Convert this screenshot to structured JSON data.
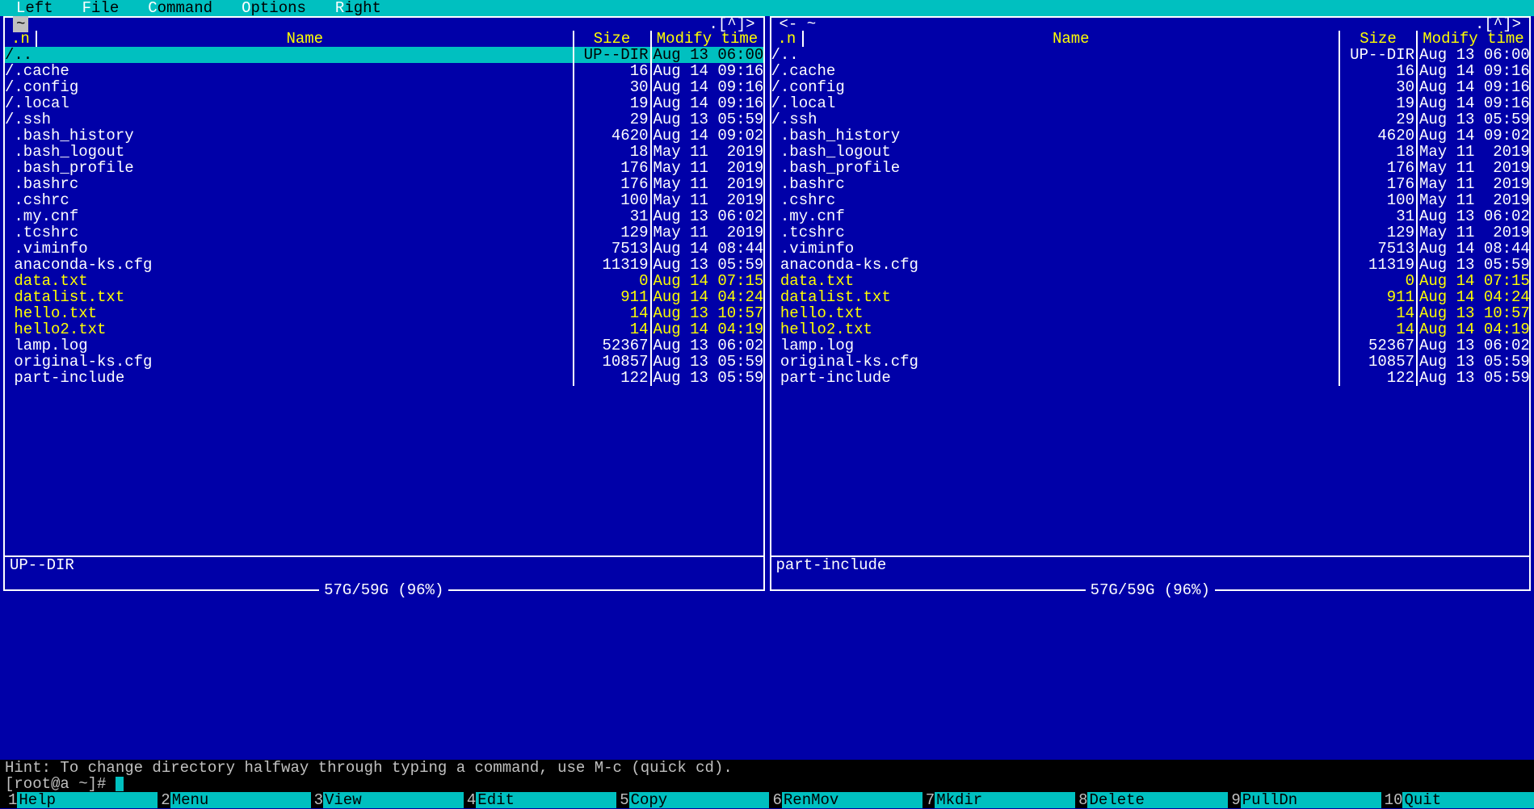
{
  "menu": {
    "left": "Left",
    "file": "File",
    "command": "Command",
    "options": "Options",
    "right": "Right"
  },
  "panel_header": {
    "n": ".n",
    "name": "Name",
    "size": "Size",
    "mtime": "Modify time"
  },
  "indicator": ".[^]>",
  "disk": "57G/59G (96%)",
  "left_panel": {
    "path": "~",
    "path_prefix": "<- ",
    "status": "UP--DIR",
    "selected": 0,
    "files": [
      {
        "name": "/..",
        "size": "UP--DIR",
        "mtime": "Aug 13 06:00",
        "cls": ""
      },
      {
        "name": "/.cache",
        "size": "16",
        "mtime": "Aug 14 09:16",
        "cls": ""
      },
      {
        "name": "/.config",
        "size": "30",
        "mtime": "Aug 14 09:16",
        "cls": ""
      },
      {
        "name": "/.local",
        "size": "19",
        "mtime": "Aug 14 09:16",
        "cls": ""
      },
      {
        "name": "/.ssh",
        "size": "29",
        "mtime": "Aug 13 05:59",
        "cls": ""
      },
      {
        "name": " .bash_history",
        "size": "4620",
        "mtime": "Aug 14 09:02",
        "cls": ""
      },
      {
        "name": " .bash_logout",
        "size": "18",
        "mtime": "May 11  2019",
        "cls": ""
      },
      {
        "name": " .bash_profile",
        "size": "176",
        "mtime": "May 11  2019",
        "cls": ""
      },
      {
        "name": " .bashrc",
        "size": "176",
        "mtime": "May 11  2019",
        "cls": ""
      },
      {
        "name": " .cshrc",
        "size": "100",
        "mtime": "May 11  2019",
        "cls": ""
      },
      {
        "name": " .my.cnf",
        "size": "31",
        "mtime": "Aug 13 06:02",
        "cls": ""
      },
      {
        "name": " .tcshrc",
        "size": "129",
        "mtime": "May 11  2019",
        "cls": ""
      },
      {
        "name": " .viminfo",
        "size": "7513",
        "mtime": "Aug 14 08:44",
        "cls": ""
      },
      {
        "name": " anaconda-ks.cfg",
        "size": "11319",
        "mtime": "Aug 13 05:59",
        "cls": ""
      },
      {
        "name": " data.txt",
        "size": "0",
        "mtime": "Aug 14 07:15",
        "cls": "y"
      },
      {
        "name": " datalist.txt",
        "size": "911",
        "mtime": "Aug 14 04:24",
        "cls": "y"
      },
      {
        "name": " hello.txt",
        "size": "14",
        "mtime": "Aug 13 10:57",
        "cls": "y"
      },
      {
        "name": " hello2.txt",
        "size": "14",
        "mtime": "Aug 14 04:19",
        "cls": "y"
      },
      {
        "name": " lamp.log",
        "size": "52367",
        "mtime": "Aug 13 06:02",
        "cls": ""
      },
      {
        "name": " original-ks.cfg",
        "size": "10857",
        "mtime": "Aug 13 05:59",
        "cls": ""
      },
      {
        "name": " part-include",
        "size": "122",
        "mtime": "Aug 13 05:59",
        "cls": ""
      }
    ]
  },
  "right_panel": {
    "path": "~",
    "path_prefix": "<- ",
    "status": "part-include",
    "selected": -1,
    "files": [
      {
        "name": "/..",
        "size": "UP--DIR",
        "mtime": "Aug 13 06:00",
        "cls": ""
      },
      {
        "name": "/.cache",
        "size": "16",
        "mtime": "Aug 14 09:16",
        "cls": ""
      },
      {
        "name": "/.config",
        "size": "30",
        "mtime": "Aug 14 09:16",
        "cls": ""
      },
      {
        "name": "/.local",
        "size": "19",
        "mtime": "Aug 14 09:16",
        "cls": ""
      },
      {
        "name": "/.ssh",
        "size": "29",
        "mtime": "Aug 13 05:59",
        "cls": ""
      },
      {
        "name": " .bash_history",
        "size": "4620",
        "mtime": "Aug 14 09:02",
        "cls": ""
      },
      {
        "name": " .bash_logout",
        "size": "18",
        "mtime": "May 11  2019",
        "cls": ""
      },
      {
        "name": " .bash_profile",
        "size": "176",
        "mtime": "May 11  2019",
        "cls": ""
      },
      {
        "name": " .bashrc",
        "size": "176",
        "mtime": "May 11  2019",
        "cls": ""
      },
      {
        "name": " .cshrc",
        "size": "100",
        "mtime": "May 11  2019",
        "cls": ""
      },
      {
        "name": " .my.cnf",
        "size": "31",
        "mtime": "Aug 13 06:02",
        "cls": ""
      },
      {
        "name": " .tcshrc",
        "size": "129",
        "mtime": "May 11  2019",
        "cls": ""
      },
      {
        "name": " .viminfo",
        "size": "7513",
        "mtime": "Aug 14 08:44",
        "cls": ""
      },
      {
        "name": " anaconda-ks.cfg",
        "size": "11319",
        "mtime": "Aug 13 05:59",
        "cls": ""
      },
      {
        "name": " data.txt",
        "size": "0",
        "mtime": "Aug 14 07:15",
        "cls": "y"
      },
      {
        "name": " datalist.txt",
        "size": "911",
        "mtime": "Aug 14 04:24",
        "cls": "y"
      },
      {
        "name": " hello.txt",
        "size": "14",
        "mtime": "Aug 13 10:57",
        "cls": "y"
      },
      {
        "name": " hello2.txt",
        "size": "14",
        "mtime": "Aug 14 04:19",
        "cls": "y"
      },
      {
        "name": " lamp.log",
        "size": "52367",
        "mtime": "Aug 13 06:02",
        "cls": ""
      },
      {
        "name": " original-ks.cfg",
        "size": "10857",
        "mtime": "Aug 13 05:59",
        "cls": ""
      },
      {
        "name": " part-include",
        "size": "122",
        "mtime": "Aug 13 05:59",
        "cls": ""
      }
    ]
  },
  "hint": "Hint: To change directory halfway through typing a command, use M-c (quick cd).",
  "prompt": "[root@a ~]# ",
  "fkeys": [
    {
      "n": "1",
      "l": "Help"
    },
    {
      "n": "2",
      "l": "Menu"
    },
    {
      "n": "3",
      "l": "View"
    },
    {
      "n": "4",
      "l": "Edit"
    },
    {
      "n": "5",
      "l": "Copy"
    },
    {
      "n": "6",
      "l": "RenMov"
    },
    {
      "n": "7",
      "l": "Mkdir"
    },
    {
      "n": "8",
      "l": "Delete"
    },
    {
      "n": "9",
      "l": "PullDn"
    },
    {
      "n": "10",
      "l": "Quit"
    }
  ]
}
